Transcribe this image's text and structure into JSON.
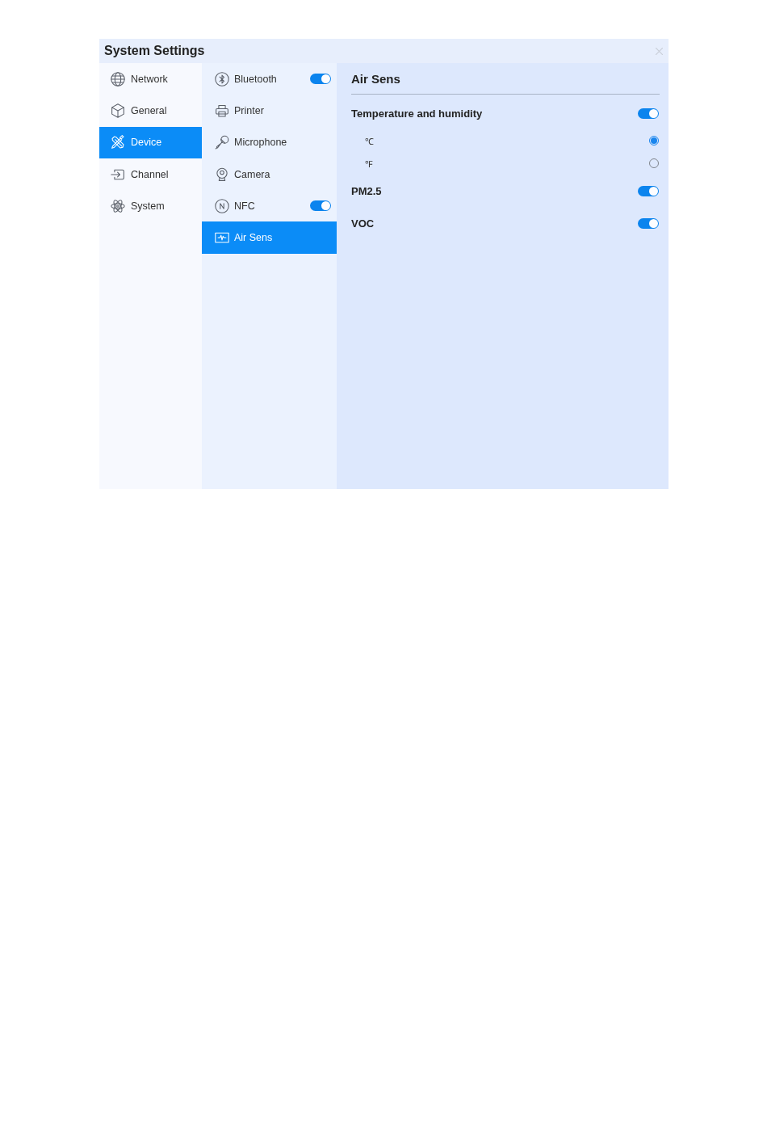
{
  "window": {
    "title": "System Settings"
  },
  "categories": [
    {
      "label": "Network",
      "selected": false
    },
    {
      "label": "General",
      "selected": false
    },
    {
      "label": "Device",
      "selected": true
    },
    {
      "label": "Channel",
      "selected": false
    },
    {
      "label": "System",
      "selected": false
    }
  ],
  "devices": [
    {
      "label": "Bluetooth",
      "selected": false,
      "kind": "toggle",
      "on": true
    },
    {
      "label": "Printer",
      "selected": false,
      "kind": "plain"
    },
    {
      "label": "Microphone",
      "selected": false,
      "kind": "plain"
    },
    {
      "label": "Camera",
      "selected": false,
      "kind": "plain"
    },
    {
      "label": "NFC",
      "selected": false,
      "kind": "toggle",
      "on": true
    },
    {
      "label": "Air Sens",
      "selected": true,
      "kind": "plain"
    }
  ],
  "panel": {
    "title": "Air Sens",
    "settings": [
      {
        "kind": "toggle",
        "label": "Temperature and humidity",
        "on": true
      },
      {
        "kind": "radio",
        "label": "℃",
        "selected": true
      },
      {
        "kind": "radio",
        "label": "℉",
        "selected": false
      },
      {
        "kind": "toggle",
        "label": "PM2.5",
        "on": true
      },
      {
        "kind": "toggle",
        "label": "VOC",
        "on": true
      }
    ]
  }
}
